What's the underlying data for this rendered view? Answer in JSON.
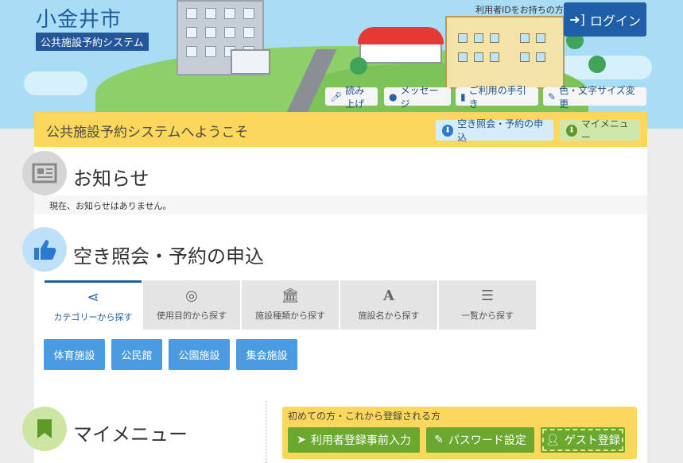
{
  "header": {
    "city_name": "小金井市",
    "system_name": "公共施設予約システム",
    "id_note": "利用者IDをお持ちの方",
    "login_label": "ログイン",
    "utilities": [
      {
        "label": "読み上げ",
        "icon": "microphone-icon"
      },
      {
        "label": "メッセージ",
        "icon": "chat-bubble-icon"
      },
      {
        "label": "ご利用の手引き",
        "icon": "book-icon"
      },
      {
        "label": "色・文字サイズ変更",
        "icon": "paintbrush-icon"
      }
    ]
  },
  "welcome": {
    "title": "公共施設予約システムへようこそ",
    "vacancy_button": "空き照会・予約の申込",
    "mymenu_button": "マイメニュー"
  },
  "notice": {
    "title": "お知らせ",
    "message": "現在、お知らせはありません。"
  },
  "reservation": {
    "title": "空き照会・予約の申込",
    "tabs": [
      {
        "label": "カテゴリーから探す",
        "icon": "share-icon",
        "active": true
      },
      {
        "label": "使用目的から探す",
        "icon": "compass-icon",
        "active": false
      },
      {
        "label": "施設種類から探す",
        "icon": "institution-icon",
        "active": false
      },
      {
        "label": "施設名から探す",
        "icon": "letter-a-icon",
        "active": false
      },
      {
        "label": "一覧から探す",
        "icon": "list-icon",
        "active": false
      }
    ],
    "categories": [
      "体育施設",
      "公民館",
      "公園施設",
      "集会施設"
    ]
  },
  "mymenu": {
    "title": "マイメニュー",
    "register_heading": "初めての方・これから登録される方",
    "buttons": [
      {
        "label": "利用者登録事前入力",
        "icon": "paper-plane-icon"
      },
      {
        "label": "パスワード設定",
        "icon": "pencil-icon"
      },
      {
        "label": "ゲスト登録",
        "icon": "user-icon"
      }
    ]
  },
  "colors": {
    "brand_blue": "#1f5fa8",
    "welcome_yellow": "#fbd75b",
    "category_blue": "#4a9be2",
    "register_green": "#6aa82f"
  }
}
